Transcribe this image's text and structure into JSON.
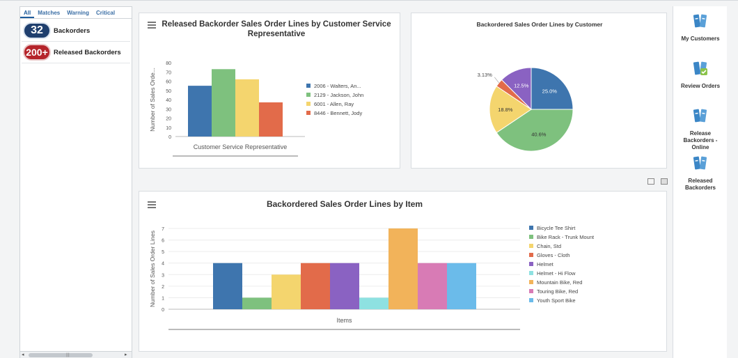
{
  "filter_tabs": [
    "All",
    "Matches",
    "Warning",
    "Critical"
  ],
  "counters": [
    {
      "count": "32",
      "label": "Backorders",
      "color": "#1f3f6e"
    },
    {
      "count": "200+",
      "label": "Released Backorders",
      "color": "#b5242a"
    }
  ],
  "scrollbar": {
    "left_arrow": "◂",
    "right_arrow": "▸",
    "grip": "|||"
  },
  "charts": {
    "csr": {
      "title": "Released Backorder Sales Order Lines by Customer Service Representative",
      "ylabel": "Number of Sales Orde...",
      "xlabel": "Customer Service Representative"
    },
    "customer": {
      "title": "Backordered Sales Order Lines by Customer"
    },
    "item": {
      "title": "Backordered Sales Order Lines by Item",
      "ylabel": "Number of Sales Order Lines",
      "xlabel": "Items"
    }
  },
  "chart_data": [
    {
      "type": "bar",
      "title": "Released Backorder Sales Order Lines by Customer Service Representative",
      "xlabel": "Customer Service Representative",
      "ylabel": "Number of Sales Orde...",
      "ylim": [
        0,
        80
      ],
      "yticks": [
        0,
        10,
        20,
        30,
        40,
        50,
        60,
        70,
        80
      ],
      "grid": false,
      "legend": "right",
      "series": [
        {
          "name": "2006 - Walters, An...",
          "value": 55,
          "color": "#3e75ae"
        },
        {
          "name": "2129 - Jackson, John",
          "value": 73,
          "color": "#7ec17e"
        },
        {
          "name": "6001 - Allen, Ray",
          "value": 62,
          "color": "#f4d56e"
        },
        {
          "name": "8446 - Bennett, Jody",
          "value": 37,
          "color": "#e26b4a"
        }
      ]
    },
    {
      "type": "pie",
      "title": "Backordered Sales Order Lines by Customer",
      "slices": [
        {
          "label": "25.0%",
          "value": 25.0,
          "color": "#3e75ae"
        },
        {
          "label": "40.6%",
          "value": 40.6,
          "color": "#7ec17e"
        },
        {
          "label": "18.8%",
          "value": 18.8,
          "color": "#f4d56e"
        },
        {
          "label": "3.13%",
          "value": 3.13,
          "color": "#e26b4a"
        },
        {
          "label": "12.5%",
          "value": 12.5,
          "color": "#8a62c2"
        }
      ]
    },
    {
      "type": "bar",
      "title": "Backordered Sales Order Lines by Item",
      "xlabel": "Items",
      "ylabel": "Number of Sales Order Lines",
      "ylim": [
        0,
        7
      ],
      "yticks": [
        0,
        1,
        2,
        3,
        4,
        5,
        6,
        7
      ],
      "grid": true,
      "legend": "right",
      "series": [
        {
          "name": "Bicycle Tee Shirt",
          "value": 4,
          "color": "#3e75ae"
        },
        {
          "name": "Bike Rack - Trunk Mount",
          "value": 1,
          "color": "#7ec17e"
        },
        {
          "name": "Chain, Std",
          "value": 3,
          "color": "#f4d56e"
        },
        {
          "name": "Gloves - Cloth",
          "value": 4,
          "color": "#e26b4a"
        },
        {
          "name": "Helmet",
          "value": 4,
          "color": "#8a62c2"
        },
        {
          "name": "Helmet - Hi Flow",
          "value": 1,
          "color": "#8ee1e1"
        },
        {
          "name": "Mountain Bike, Red",
          "value": 7,
          "color": "#f2b35a"
        },
        {
          "name": "Touring Bike, Red",
          "value": 4,
          "color": "#d87bb5"
        },
        {
          "name": "Youth Sport Bike",
          "value": 4,
          "color": "#6bbbea"
        }
      ]
    }
  ],
  "actions": [
    {
      "label": "My Customers",
      "icon": "binder-icon"
    },
    {
      "label": "Review Orders",
      "icon": "binder-check-icon"
    },
    {
      "label": "Release Backorders - Online",
      "icon": "binder-icon"
    },
    {
      "label": "Released Backorders",
      "icon": "binder-icon"
    }
  ],
  "colors": {
    "accent": "#1d5b9c",
    "binder": "#3b86c6"
  }
}
